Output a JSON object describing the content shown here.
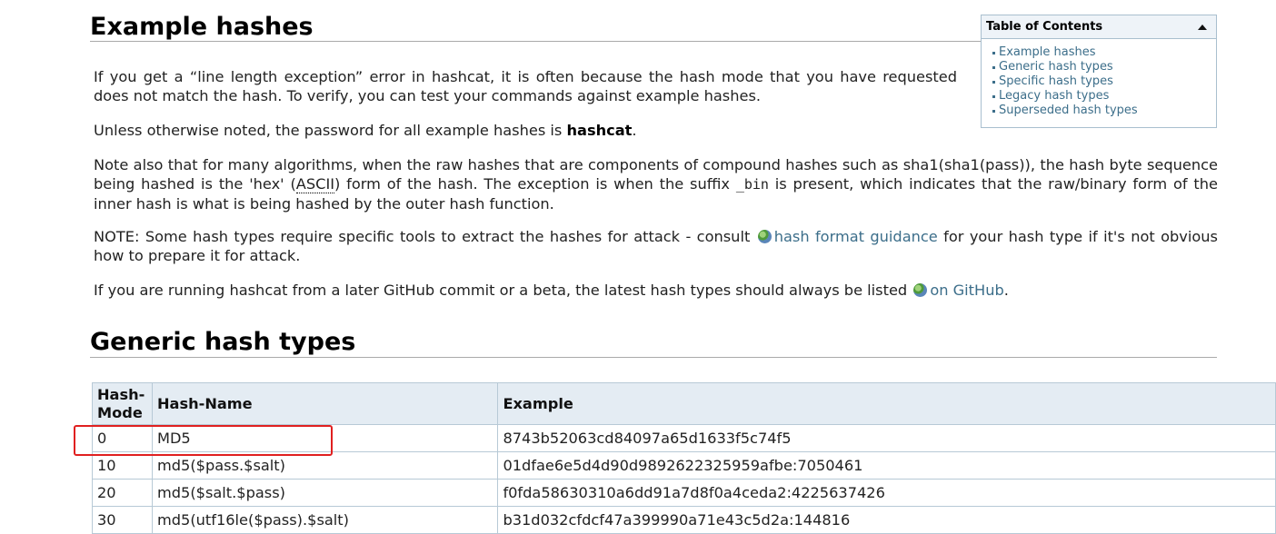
{
  "section1": {
    "title": "Example hashes",
    "p1": "If you get a “line length exception” error in hashcat, it is often because the hash mode that you have requested does not match the hash. To verify, you can test your commands against example hashes.",
    "p2_pre": "Unless otherwise noted, the password for all example hashes is ",
    "p2_bold": "hashcat",
    "p2_post": ".",
    "p3_a": "Note also that for many algorithms, when the raw hashes that are components of compound hashes such as sha1(sha1(pass)), the hash byte sequence being hashed is the 'hex' (",
    "p3_abbr": "ASCII",
    "p3_b": ") form of the hash. The exception is when the suffix ",
    "p3_code": "_bin",
    "p3_c": " is present, which indicates that the raw/binary form of the inner hash is what is being hashed by the outer hash function.",
    "p4_a": "NOTE: Some hash types require specific tools to extract the hashes for attack - consult ",
    "p4_link": "hash format guidance",
    "p4_b": " for your hash type if it's not obvious how to prepare it for attack.",
    "p5_a": "If you are running hashcat from a later GitHub commit or a beta, the latest hash types should always be listed ",
    "p5_link": "on GitHub",
    "p5_b": "."
  },
  "toc": {
    "title": "Table of Contents",
    "items": [
      "Example hashes",
      "Generic hash types",
      "Specific hash types",
      "Legacy hash types",
      "Superseded hash types"
    ]
  },
  "section2": {
    "title": "Generic hash types"
  },
  "table": {
    "headers": [
      "Hash-\nMode",
      "Hash-Name",
      "Example"
    ],
    "header_mode_l1": "Hash-",
    "header_mode_l2": "Mode",
    "header_name": "Hash-Name",
    "header_example": "Example",
    "rows": [
      {
        "mode": "0",
        "name": "MD5",
        "example": "8743b52063cd84097a65d1633f5c74f5"
      },
      {
        "mode": "10",
        "name": "md5($pass.$salt)",
        "example": "01dfae6e5d4d90d9892622325959afbe:7050461"
      },
      {
        "mode": "20",
        "name": "md5($salt.$pass)",
        "example": "f0fda58630310a6dd91a7d8f0a4ceda2:4225637426"
      },
      {
        "mode": "30",
        "name": "md5(utf16le($pass).$salt)",
        "example": "b31d032cfdcf47a399990a71e43c5d2a:144816"
      }
    ]
  },
  "colors": {
    "link": "#3c6e8a",
    "table_header": "#e4ecf3",
    "highlight": "#e02020"
  }
}
